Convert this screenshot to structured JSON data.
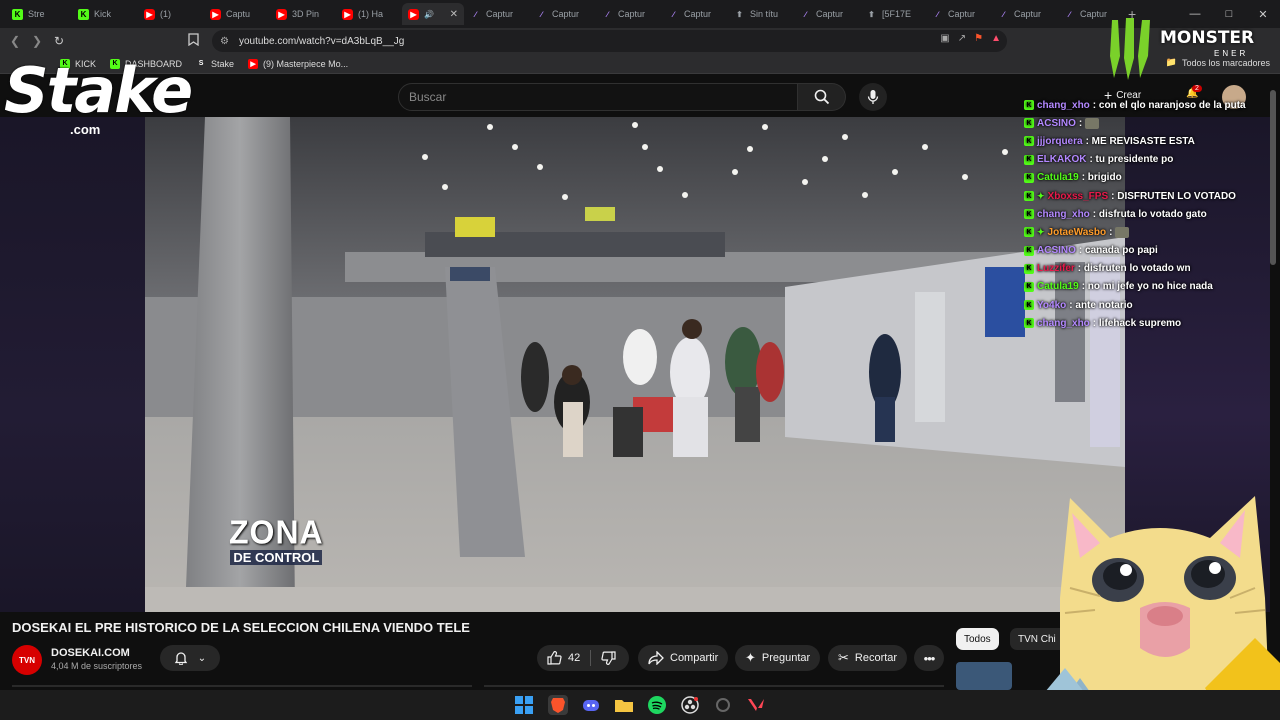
{
  "browser": {
    "tabs": [
      {
        "label": "Stre",
        "favicon": "kick"
      },
      {
        "label": "Kick",
        "favicon": "kick"
      },
      {
        "label": "(1) ",
        "favicon": "youtube"
      },
      {
        "label": "Captu",
        "favicon": "youtube"
      },
      {
        "label": "3D Pin",
        "favicon": "youtube"
      },
      {
        "label": "(1) Ha",
        "favicon": "youtube"
      },
      {
        "label": "",
        "favicon": "youtube",
        "active": true
      },
      {
        "label": "Captur",
        "favicon": "capture"
      },
      {
        "label": "Captur",
        "favicon": "capture"
      },
      {
        "label": "Captur",
        "favicon": "capture"
      },
      {
        "label": "Captur",
        "favicon": "capture"
      },
      {
        "label": "Sin títu",
        "favicon": "doc"
      },
      {
        "label": "Captur",
        "favicon": "capture"
      },
      {
        "label": "[5F17E",
        "favicon": "doc"
      },
      {
        "label": "Captur",
        "favicon": "capture"
      },
      {
        "label": "Captur",
        "favicon": "capture"
      },
      {
        "label": "Captur",
        "favicon": "capture"
      }
    ],
    "url": "youtube.com/watch?v=dA3bLqB__Jg",
    "bookmarks": [
      {
        "label": "KICK",
        "favicon": "kick"
      },
      {
        "label": "DASHBOARD",
        "favicon": "kick"
      },
      {
        "label": "Stake",
        "favicon": "stake"
      },
      {
        "label": "(9) Masterpiece Mo...",
        "favicon": "youtube"
      }
    ],
    "all_bookmarks": "Todos los marcadores",
    "accent_color": "#53fc18"
  },
  "youtube": {
    "search_placeholder": "Buscar",
    "create_label": "Crear",
    "notif_count": "2",
    "video": {
      "overlay_title": "ZONA",
      "overlay_subtitle": "DE CONTROL"
    },
    "title": "DOSEKAI EL PRE HISTORICO DE LA SELECCION CHILENA VIENDO TELE",
    "channel": {
      "avatar_text": "TVN",
      "name": "DOSEKAI.COM",
      "subscribers": "4,04 M de suscriptores"
    },
    "actions": {
      "likes": "42",
      "share": "Compartir",
      "ask": "Preguntar",
      "clip": "Recortar"
    },
    "chips": {
      "all": "Todos",
      "other": "TVN Chi"
    }
  },
  "overlay": {
    "stake_logo": "Stake",
    "stake_dotcom": ".com",
    "monster_word": "MONSTER",
    "monster_sub": "ENER"
  },
  "chat": [
    {
      "user": "chang_xho",
      "color": "#b388ff",
      "text": ": con el qlo naranjoso de la puta",
      "badge": "kick"
    },
    {
      "user": "ACSINO",
      "color": "#b388ff",
      "text": ":",
      "badge": "kick",
      "emote": true
    },
    {
      "user": "jjjorquera",
      "color": "#b388ff",
      "text": ": ME REVISASTE ESTA",
      "badge": "kick"
    },
    {
      "user": "ELKAKOK",
      "color": "#b388ff",
      "text": ": tu presidente po",
      "badge": "kick"
    },
    {
      "user": "Catula19",
      "color": "#53fc18",
      "text": ": brigido",
      "badge": "kick"
    },
    {
      "user": "Xboxss_FPS",
      "color": "#e8194a",
      "text": ": DISFRUTEN LO VOTADO",
      "badge": "kick",
      "gem": true
    },
    {
      "user": "chang_xho",
      "color": "#b388ff",
      "text": ": disfruta lo votado gato",
      "badge": "kick"
    },
    {
      "user": "JotaeWasbo",
      "color": "#ff9c2a",
      "text": ":",
      "badge": "kick",
      "gem": true,
      "emote": true
    },
    {
      "user": "ACSINO",
      "color": "#b388ff",
      "text": ": canada po papi",
      "badge": "kick"
    },
    {
      "user": "Luzzifer",
      "color": "#e8194a",
      "text": ": disfruten lo votado wn",
      "badge": "kick"
    },
    {
      "user": "Catula19",
      "color": "#53fc18",
      "text": ": no mi jefe yo no hice nada",
      "badge": "kick"
    },
    {
      "user": "Yo4ko",
      "color": "#b388ff",
      "text": ": ante notario",
      "badge": "kick"
    },
    {
      "user": "chang_xho",
      "color": "#b388ff",
      "text": ": lifehack supremo",
      "badge": "kick"
    }
  ]
}
